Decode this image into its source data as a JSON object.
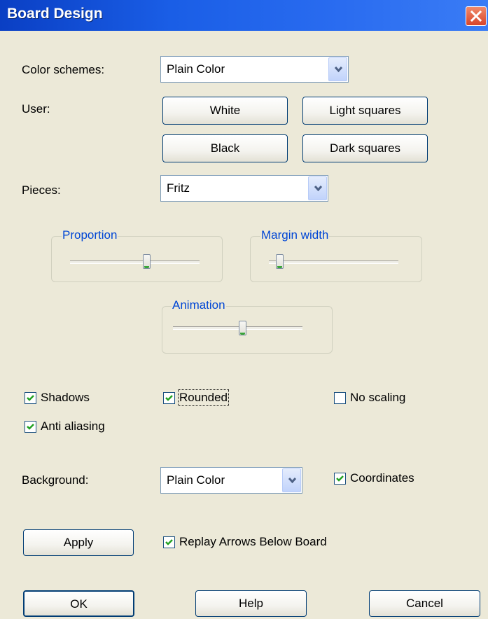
{
  "window": {
    "title": "Board Design"
  },
  "labels": {
    "color_schemes": "Color schemes:",
    "user": "User:",
    "pieces": "Pieces:",
    "background": "Background:"
  },
  "combos": {
    "color_scheme": "Plain Color",
    "pieces": "Fritz",
    "background": "Plain Color"
  },
  "user_buttons": {
    "white": "White",
    "light_squares": "Light squares",
    "black": "Black",
    "dark_squares": "Dark squares"
  },
  "sliders": {
    "proportion": {
      "label": "Proportion",
      "level": 0.6
    },
    "margin_width": {
      "label": "Margin width",
      "level": 0.1
    },
    "animation": {
      "label": "Animation",
      "level": 0.55
    }
  },
  "checkboxes": {
    "shadows": {
      "label": "Shadows",
      "checked": true
    },
    "rounded": {
      "label": "Rounded",
      "checked": true
    },
    "no_scaling": {
      "label": "No scaling",
      "checked": false
    },
    "anti_aliasing": {
      "label": "Anti aliasing",
      "checked": true
    },
    "coordinates": {
      "label": "Coordinates",
      "checked": true
    },
    "replay_arrows": {
      "label": "Replay Arrows Below Board",
      "checked": true
    }
  },
  "buttons": {
    "apply": "Apply",
    "ok": "OK",
    "help": "Help",
    "cancel": "Cancel"
  },
  "icons": {
    "close": "close-icon",
    "dropdown": "chevron-down-icon",
    "check": "check-icon"
  },
  "colors": {
    "titlebar": "#0a3fc4",
    "group_label": "#0046d5",
    "check": "#21a121",
    "dialog_bg": "#ece9d8"
  }
}
